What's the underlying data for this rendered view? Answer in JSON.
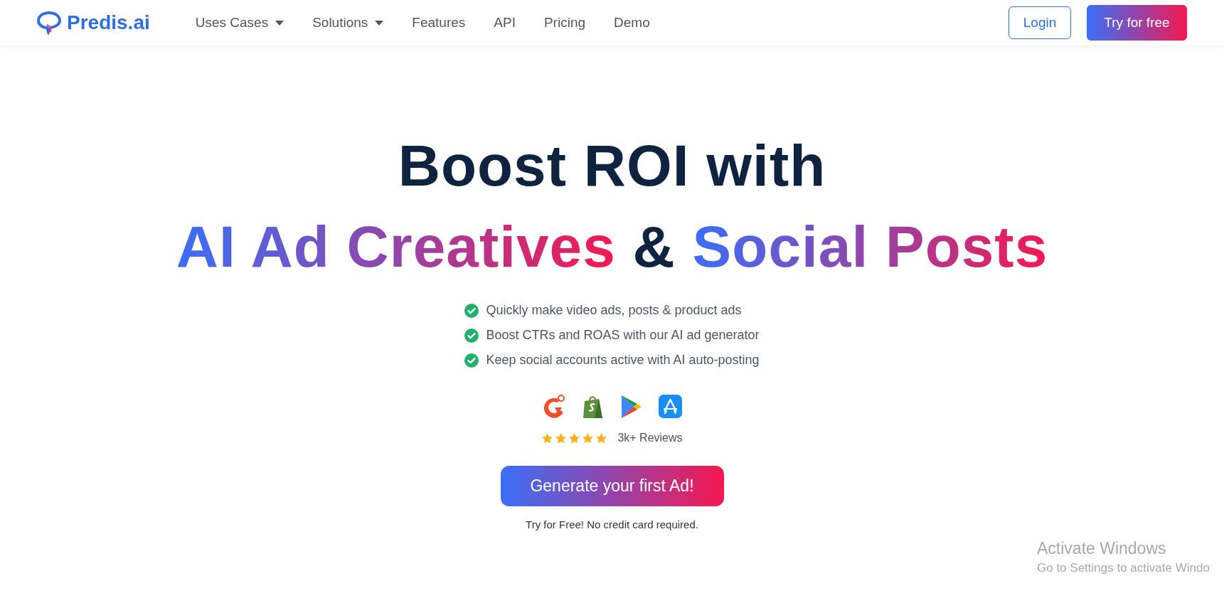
{
  "nav": {
    "logo": "Predis.ai",
    "items": [
      {
        "label": "Uses Cases",
        "dropdown": true
      },
      {
        "label": "Solutions",
        "dropdown": true
      },
      {
        "label": "Features",
        "dropdown": false
      },
      {
        "label": "API",
        "dropdown": false
      },
      {
        "label": "Pricing",
        "dropdown": false
      },
      {
        "label": "Demo",
        "dropdown": false
      }
    ],
    "login": "Login",
    "cta": "Try for free"
  },
  "hero": {
    "lines": [
      [
        {
          "kind": "plain",
          "text": "Boost ROI with"
        }
      ],
      [
        {
          "kind": "gradient",
          "text": "AI Ad Creatives"
        },
        {
          "kind": "plain",
          "text": " & "
        },
        {
          "kind": "gradient",
          "text": "Social Posts"
        }
      ]
    ],
    "bullets": [
      "Quickly make video ads, posts & product ads",
      "Boost CTRs and ROAS with our AI ad generator",
      "Keep social accounts active with AI auto-posting"
    ],
    "platforms": [
      {
        "kind": "g2"
      },
      {
        "kind": "shop"
      },
      {
        "kind": "play"
      },
      {
        "kind": "store"
      }
    ],
    "rating": {
      "stars": 5,
      "label": "3k+ Reviews"
    },
    "button": "Generate your first Ad!",
    "note": "Try for Free! No credit card required."
  },
  "overlay": {
    "title": "Activate Windows",
    "subtitle": "Go to Settings to activate Windo"
  }
}
